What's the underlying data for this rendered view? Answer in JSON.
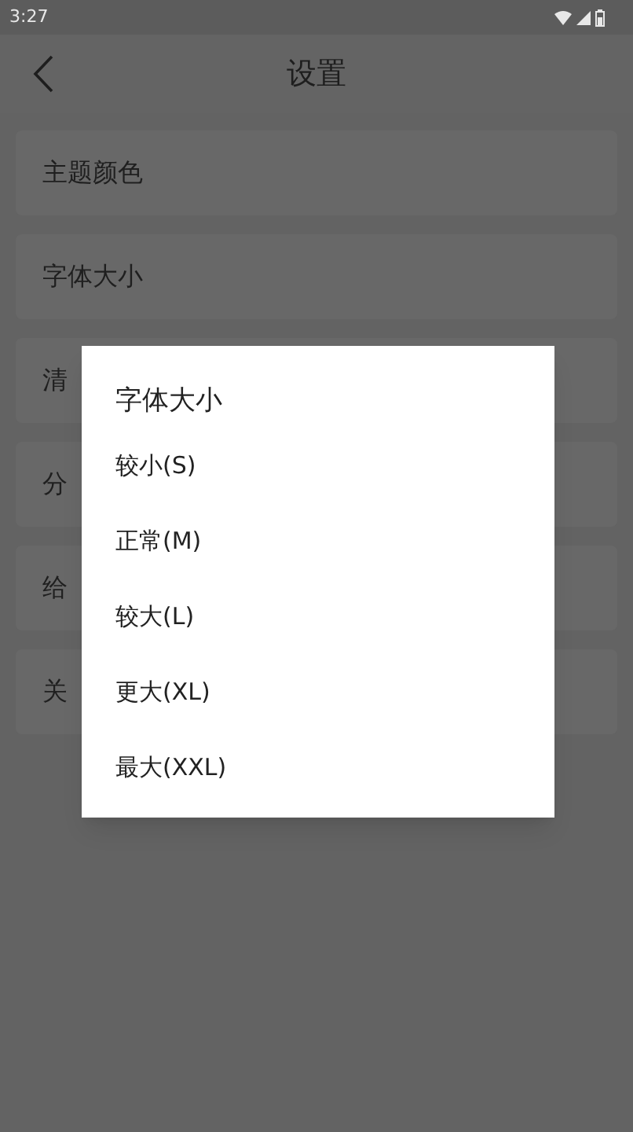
{
  "status_bar": {
    "time": "3:27"
  },
  "header": {
    "title": "设置"
  },
  "settings": [
    {
      "label": "主题颜色"
    },
    {
      "label": "字体大小"
    },
    {
      "label": "清"
    },
    {
      "label": "分"
    },
    {
      "label": "给"
    },
    {
      "label": "关"
    }
  ],
  "dialog": {
    "title": "字体大小",
    "options": [
      {
        "label": "较小(S)"
      },
      {
        "label": "正常(M)"
      },
      {
        "label": "较大(L)"
      },
      {
        "label": "更大(XL)"
      },
      {
        "label": "最大(XXL)"
      }
    ]
  }
}
